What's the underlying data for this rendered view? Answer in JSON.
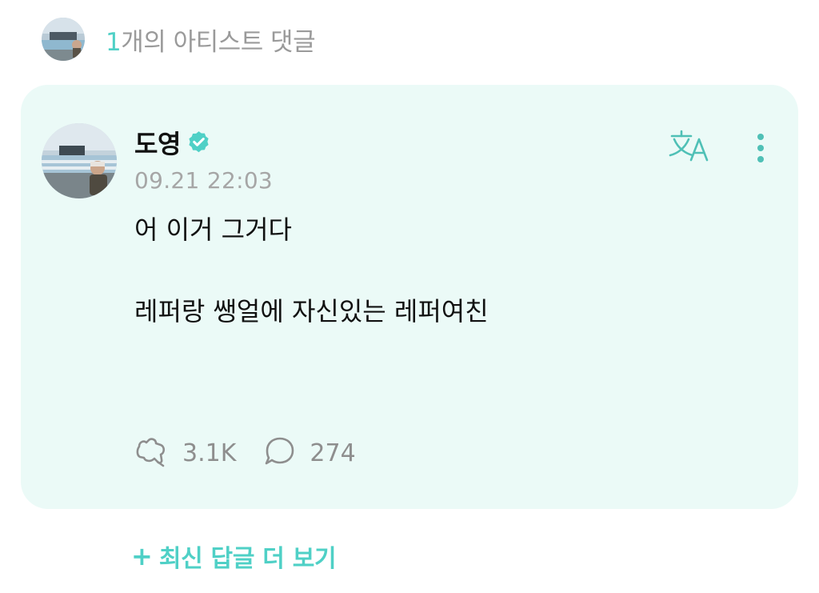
{
  "header": {
    "count": "1",
    "title_suffix": "개의 아티스트 댓글"
  },
  "comment": {
    "author": "도영",
    "timestamp": "09.21 22:03",
    "lines": [
      "어 이거 그거다",
      "레퍼랑 쌩얼에 자신있는 레퍼여친"
    ],
    "likes": "3.1K",
    "replies": "274"
  },
  "more_replies_label": "최신 답글 더 보기",
  "icons": {
    "verified": "verified-badge-icon",
    "translate": "translate-icon",
    "more": "more-vertical-icon",
    "like": "like-icon",
    "reply": "reply-bubble-icon",
    "plus": "plus-icon"
  },
  "colors": {
    "accent": "#4fd0c6",
    "card_bg": "#ebfaf7",
    "muted": "#9a9a9a"
  }
}
